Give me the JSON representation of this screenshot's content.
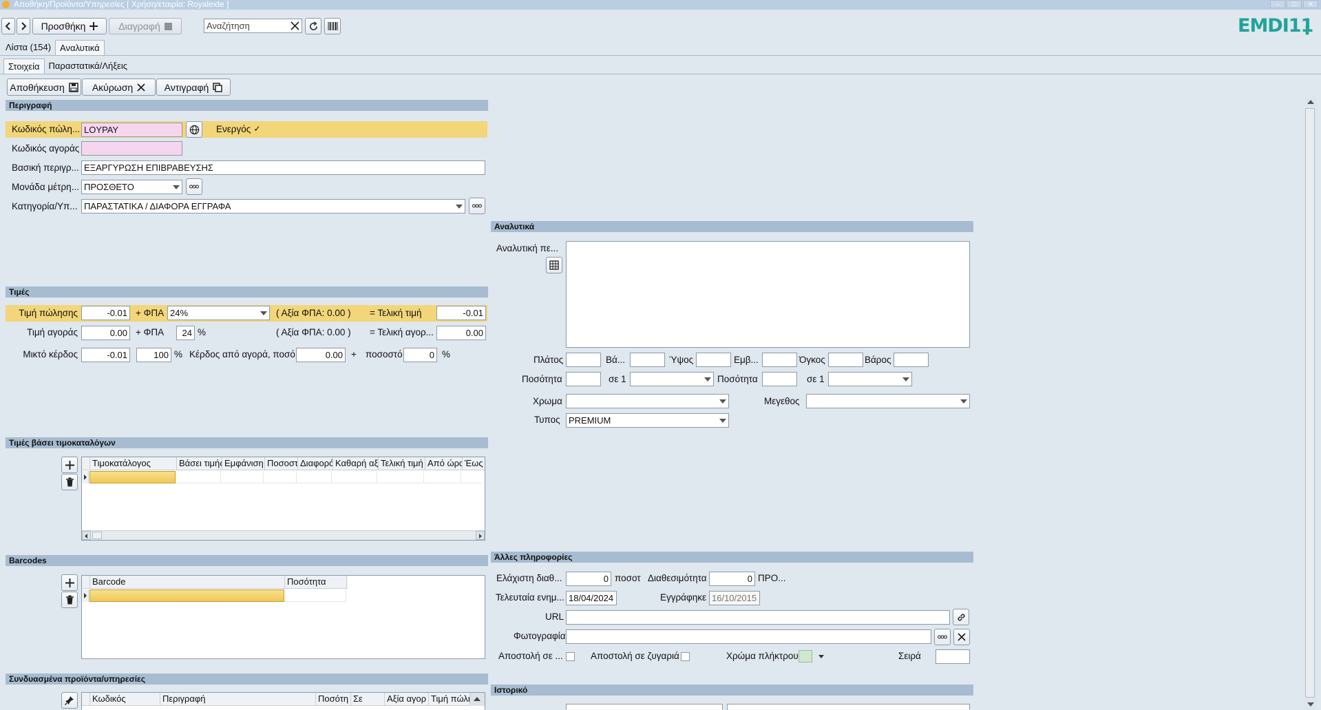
{
  "window": {
    "title": "Αποθήκη/Προϊόντα/Υπηρεσίες  [ Χρήση/εταιρία: Royalexte ]"
  },
  "toolbar": {
    "add_label": "Προσθήκη",
    "delete_label": "Διαγραφή",
    "search_placeholder": "Αναζήτηση"
  },
  "brand": {
    "logo_text": "EMDI11"
  },
  "main_tabs": [
    {
      "label": "Λίστα (154)"
    },
    {
      "label": "Αναλυτικά"
    }
  ],
  "sub_tabs": [
    {
      "label": "Στοιχεία"
    },
    {
      "label": "Παραστατικά/Λήξεις"
    }
  ],
  "actions": {
    "save_label": "Αποθήκευση",
    "cancel_label": "Ακύρωση",
    "copy_label": "Αντιγραφή"
  },
  "description": {
    "header": "Περιγραφή",
    "sales_code_label": "Κωδικός πώλη...",
    "sales_code_value": "LOYPAY",
    "active_label": "Ενεργός",
    "active_checked": "✓",
    "purchase_code_label": "Κωδικός αγοράς",
    "purchase_code_value": "",
    "basic_desc_label": "Βασική περιγρ...",
    "basic_desc_value": "ΕΞΑΡΓΥΡΩΣΗ ΕΠΙΒΡΑΒΕΥΣΗΣ",
    "unit_label": "Μονάδα μέτρη...",
    "unit_value": "ΠΡΟΣΘΕΤΟ",
    "category_label": "Κατηγορία/Υπ...",
    "category_value": "ΠΑΡΑΣΤΑΤΙΚΑ / ΔΙΑΦΟΡΑ ΕΓΓΡΑΦΑ"
  },
  "prices": {
    "header": "Τιμές",
    "sale_label": "Τιμή πώλησης",
    "sale_value": "-0.01",
    "vat_plus": "+ ΦΠΑ",
    "vat_rate": "24%",
    "sale_vat_amount": "( Αξία ΦΠΑ: 0.00 )",
    "final_label": "= Τελική τιμή",
    "final_value": "-0.01",
    "purchase_label": "Τιμή αγοράς",
    "purchase_value": "0.00",
    "purchase_vat_rate": "24",
    "percent": "%",
    "purchase_vat_amount": "( Αξία ΦΠΑ: 0.00 )",
    "final_purchase_label": "= Τελική αγορ...",
    "final_purchase_value": "0.00",
    "gross_profit_label": "Μικτό κέρδος",
    "gross_profit_value": "-0.01",
    "gross_profit_pct": "100",
    "profit_from_purchase_label": "Κέρδος από αγορά, ποσό",
    "profit_amount": "0.00",
    "plus": "+",
    "percentage_label": "ποσοστό",
    "percentage_value": "0"
  },
  "pricelists": {
    "header": "Τιμές βάσει τιμοκαταλόγων",
    "columns": [
      "Τιμοκατάλογος",
      "Βάσει τιμής",
      "Εμφάνιση",
      "Ποσοστ",
      "Διαφορά",
      "Καθαρή αξ",
      "Τελική τιμή",
      "Από ώρα",
      "Έως"
    ]
  },
  "barcodes": {
    "header": "Barcodes",
    "columns": [
      "Barcode",
      "Ποσότητα"
    ]
  },
  "related": {
    "header": "Συνδυασμένα προϊόντα/υπηρεσίες",
    "columns": [
      "Κωδικός",
      "Περιγραφή",
      "Ποσότη",
      "Σε",
      "Αξία αγορ",
      "Τιμή πώλη"
    ]
  },
  "analytics": {
    "header": "Αναλυτικά",
    "detail_label": "Αναλυτική πε...",
    "width_label": "Πλάτος",
    "depth_label": "Βά...",
    "height_label": "Ύψος",
    "area_label": "Εμβ...",
    "volume_label": "Όγκος",
    "weight_label": "Βάρος",
    "qty_label": "Ποσότητα",
    "in_one_label": "σε 1",
    "qty2_label": "Ποσότητα",
    "in_one2_label": "σε 1",
    "color_label": "Χρωμα",
    "size_label": "Μεγεθος",
    "type_label": "Τυπος",
    "type_value": "PREMIUM"
  },
  "other": {
    "header": "Άλλες πληροφορίες",
    "min_avail_label": "Ελάχιστη διαθ...",
    "min_avail_value": "0",
    "qty_unit": "ποσοτ",
    "availability_label": "Διαθεσιμότητα",
    "availability_value": "0",
    "availability_unit": "ΠΡΟ...",
    "last_update_label": "Τελευταία ενημ...",
    "last_update_value": "18/04/2024",
    "registered_label": "Εγγράφηκε",
    "registered_value": "16/10/2015",
    "url_label": "URL",
    "url_value": "",
    "photo_label": "Φωτογραφία",
    "photo_value": "",
    "send_label": "Αποστολή σε ...",
    "send_scale_label": "Αποστολή σε ζυγαριά",
    "key_color_label": "Χρώμα πλήκτρου",
    "order_label": "Σειρά",
    "order_value": ""
  },
  "history": {
    "header": "Ιστορικό"
  },
  "colors": {
    "highlight": "#f2d679",
    "section": "#a7bcd0",
    "pink_input": "#f6d6ef",
    "logo": "#22a39a",
    "key_color": "#cfe8cf"
  }
}
